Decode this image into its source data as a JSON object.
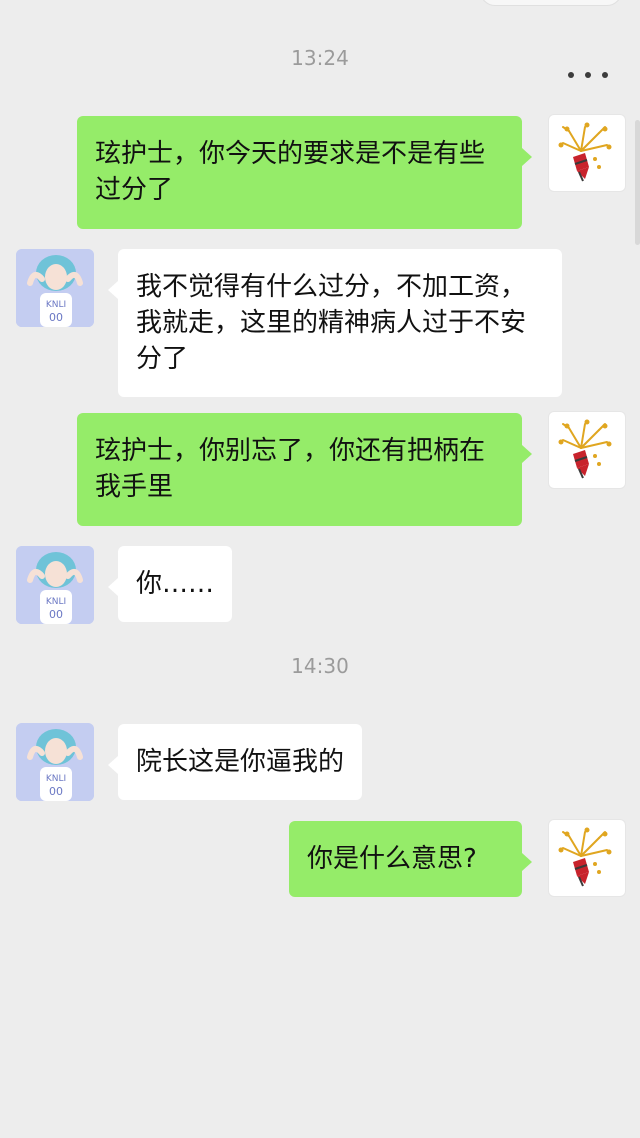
{
  "header": {
    "menu_icon": "more-dots-icon"
  },
  "timestamps": [
    "13:24",
    "14:30"
  ],
  "messages": [
    {
      "side": "sent",
      "text": "玹护士，你今天的要求是不是有些过分了"
    },
    {
      "side": "received",
      "text": "我不觉得有什么过分，不加工资，我就走，这里的精神病人过于不安分了"
    },
    {
      "side": "sent",
      "text": "玹护士，你别忘了，你还有把柄在我手里"
    },
    {
      "side": "received",
      "text": "你……"
    },
    {
      "side": "received",
      "text": "院长这是你逼我的"
    },
    {
      "side": "sent",
      "text": "你是什么意思?"
    }
  ],
  "avatars": {
    "me": "firework-avatar-icon",
    "other": "girl-photo-avatar"
  },
  "colors": {
    "background": "#ededed",
    "sent_bubble": "#95ec69",
    "received_bubble": "#ffffff",
    "timestamp": "#9b9b9b"
  }
}
